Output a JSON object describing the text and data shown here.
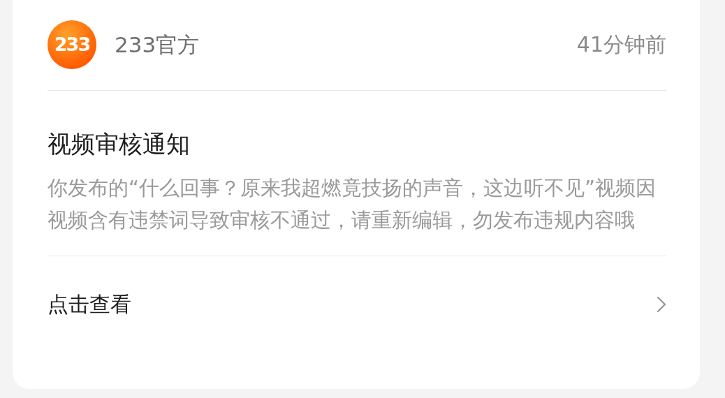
{
  "message": {
    "sender": {
      "logo_text": "233",
      "name": "233官方"
    },
    "time": "41分钟前",
    "title": "视频审核通知",
    "body": "你发布的“什么回事？原来我超燃竟技扬的声音，这边听不见”视频因视频含有违禁词导致审核不通过，请重新编辑，勿发布违规内容哦",
    "action": {
      "label": "点击查看"
    }
  }
}
